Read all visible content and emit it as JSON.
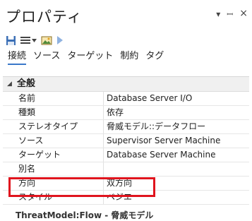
{
  "window": {
    "title": "プロパティ",
    "icons": [
      "chevron-down-icon",
      "pin-icon",
      "close-icon"
    ],
    "icon_glyphs": [
      "▾",
      "ꟷ",
      "×"
    ]
  },
  "toolbar": {
    "icons": [
      "save-icon",
      "menu-icon",
      "image-icon",
      "play-icon"
    ]
  },
  "tabs": [
    {
      "label": "接続",
      "active": true
    },
    {
      "label": "ソース",
      "active": false
    },
    {
      "label": "ターゲット",
      "active": false
    },
    {
      "label": "制約",
      "active": false
    },
    {
      "label": "タグ",
      "active": false
    }
  ],
  "section": {
    "title": "全般",
    "expanded": true,
    "rows": [
      {
        "name": "名前",
        "value": "Database Server I/O"
      },
      {
        "name": "種類",
        "value": "依存"
      },
      {
        "name": "ステレオタイプ",
        "value": "脅威モデル::データフロー"
      },
      {
        "name": "ソース",
        "value": "Supervisor Server Machine"
      },
      {
        "name": "ターゲット",
        "value": "Database Server Machine"
      },
      {
        "name": "別名",
        "value": ""
      },
      {
        "name": "方向",
        "value": "双方向"
      },
      {
        "name": "スタイル",
        "value": "ベジエ"
      }
    ]
  },
  "next_section_partial": "ThreatModel:Flow - 脅威モデル",
  "colors": {
    "accent": "#3a78c9",
    "highlight": "#e0141e"
  }
}
